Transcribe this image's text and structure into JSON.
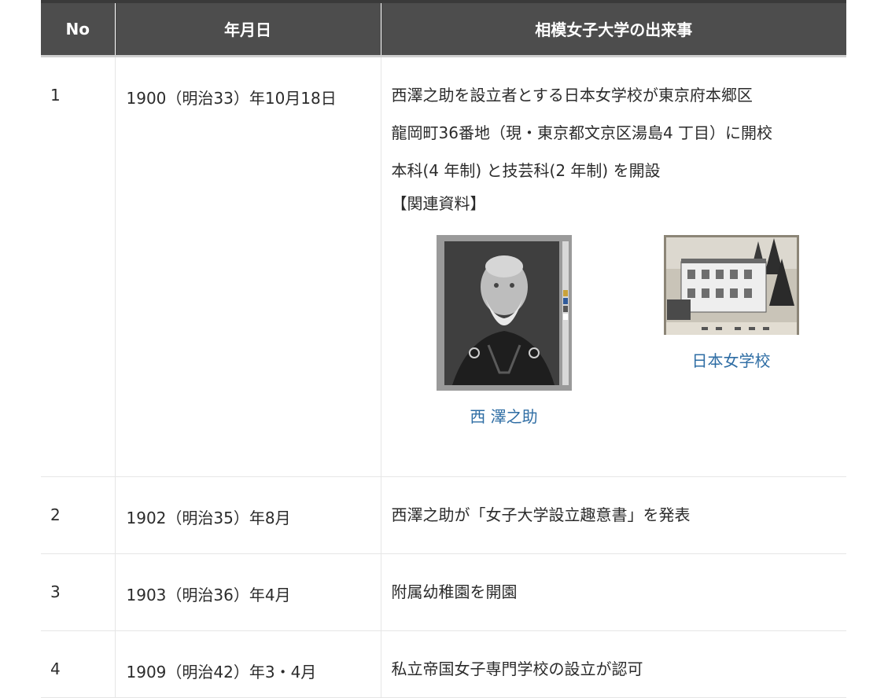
{
  "table": {
    "headers": {
      "no": "No",
      "date": "年月日",
      "event": "相模女子大学の出来事"
    },
    "rows": [
      {
        "no": "1",
        "date": "1900（明治33）年10月18日",
        "lines": [
          "西澤之助を設立者とする日本女学校が東京府本郷区",
          "龍岡町36番地（現・東京都文京区湯島4 丁目）に開校",
          "本科(4 年制) と技芸科(2 年制) を開設",
          "【関連資料】"
        ],
        "figures": [
          {
            "caption": "西 澤之助",
            "icon": "portrait-photo"
          },
          {
            "caption": "日本女学校",
            "icon": "school-building-photo"
          }
        ]
      },
      {
        "no": "2",
        "date": "1902（明治35）年8月",
        "lines": [
          "西澤之助が「女子大学設立趣意書」を発表"
        ]
      },
      {
        "no": "3",
        "date": "1903（明治36）年4月",
        "lines": [
          "附属幼稚園を開園"
        ]
      },
      {
        "no": "4",
        "date": "1909（明治42）年3・4月",
        "lines": [
          "私立帝国女子専門学校の設立が認可"
        ]
      }
    ]
  },
  "colors": {
    "header_bg": "#4d4d4d",
    "header_text": "#ffffff",
    "link": "#2e6da4",
    "border": "#e6e6e6"
  }
}
